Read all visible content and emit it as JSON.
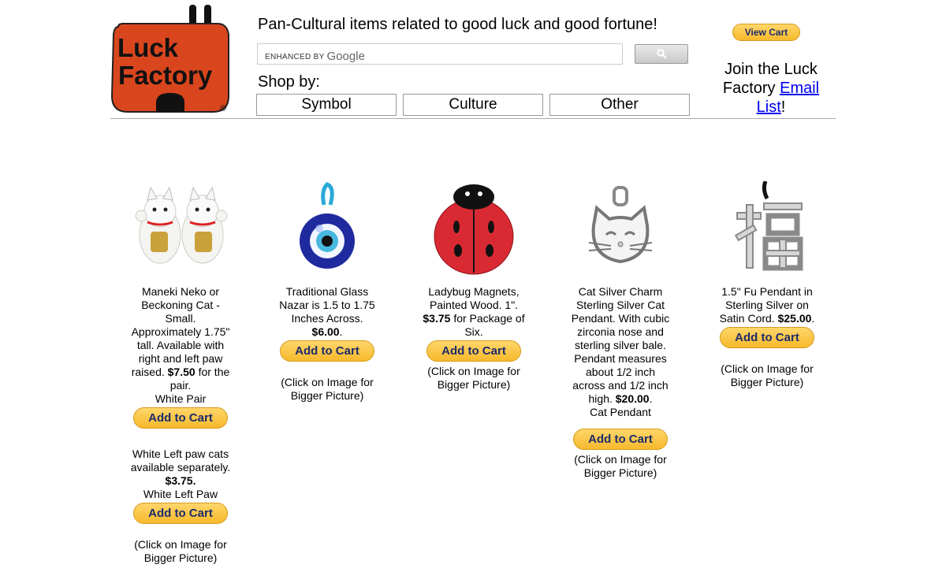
{
  "header": {
    "logo_line1": "Luck",
    "logo_line2": "Factory",
    "logo_mark": "®",
    "tagline": "Pan-Cultural items related to good luck and good fortune!",
    "search_brand": "ENHANCED BY",
    "search_google": "Google",
    "search_value": "",
    "shop_by": "Shop by:",
    "shop_buttons": [
      "Symbol",
      "Culture",
      "Other"
    ],
    "view_cart": "View Cart",
    "join_prefix": "Join the Luck Factory",
    "join_link": "Email List",
    "join_suffix": "!"
  },
  "products": [
    {
      "image": "maneki-neko-pair",
      "desc": "Maneki Neko or Beckoning Cat - Small. Approximately 1.75\" tall. Available with right and left paw raised.",
      "price": "$7.50",
      "desc_after": " for the pair.",
      "option1": "White Pair",
      "cart1": "Add to Cart",
      "extra": "White Left paw cats available separately.",
      "extra_price": "$3.75.",
      "option2": "White Left Paw",
      "cart2": "Add to Cart",
      "click": "(Click on Image for Bigger Picture)"
    },
    {
      "image": "glass-nazar",
      "desc": "Traditional Glass Nazar is 1.5 to 1.75 Inches Across.",
      "price": "$6.00",
      "desc_after": ".",
      "cart": "Add to Cart",
      "click": "(Click on Image for Bigger Picture)"
    },
    {
      "image": "ladybug",
      "desc": "Ladybug Magnets, Painted Wood. 1\".",
      "price": "$3.75",
      "desc_after": " for Package of Six.",
      "cart": "Add to Cart",
      "click": "(Click on Image for Bigger Picture)"
    },
    {
      "image": "cat-charm",
      "desc": "Cat Silver Charm Sterling Silver Cat Pendant. With cubic zirconia nose and sterling silver bale. Pendant measures about 1/2 inch across and 1/2 inch high.",
      "price": "$20.00",
      "desc_after": ".",
      "option": "Cat Pendant",
      "cart": "Add to Cart",
      "click": "(Click on Image for Bigger Picture)"
    },
    {
      "image": "fu-pendant",
      "desc": "1.5\" Fu Pendant in Sterling Silver on Satin Cord.",
      "price": "$25.00",
      "desc_after": ".",
      "cart": "Add to Cart",
      "click": "(Click on Image for Bigger Picture)"
    }
  ]
}
